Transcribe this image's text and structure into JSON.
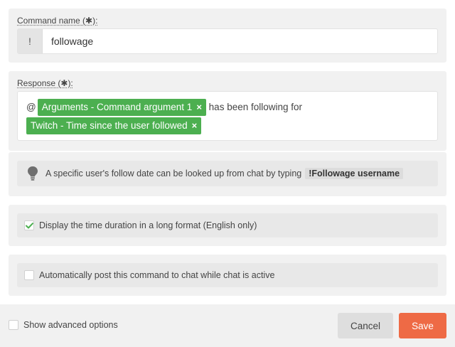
{
  "command": {
    "label": "Command name (",
    "label_end": "):",
    "required_mark": "✱",
    "prefix": "!",
    "value": "followage"
  },
  "response": {
    "label": "Response (",
    "label_end": "):",
    "required_mark": "✱",
    "at": "@",
    "token1": "Arguments - Command argument 1",
    "middle": "has been following for",
    "token2": "Twitch - Time since the user followed",
    "remove_glyph": "×"
  },
  "tip": {
    "text": "A specific user's follow date can be looked up from chat by typing",
    "code": "!Followage username",
    "icon": "lightbulb-icon"
  },
  "options": {
    "long_format": {
      "label": "Display the time duration in a long format (English only)",
      "checked": true
    },
    "auto_post": {
      "label": "Automatically post this command to chat while chat is active",
      "checked": false
    }
  },
  "footer": {
    "advanced_label": "Show advanced options",
    "cancel_label": "Cancel",
    "save_label": "Save"
  },
  "colors": {
    "token": "#4caf50",
    "save": "#ee6a45",
    "check": "#4caf50"
  }
}
